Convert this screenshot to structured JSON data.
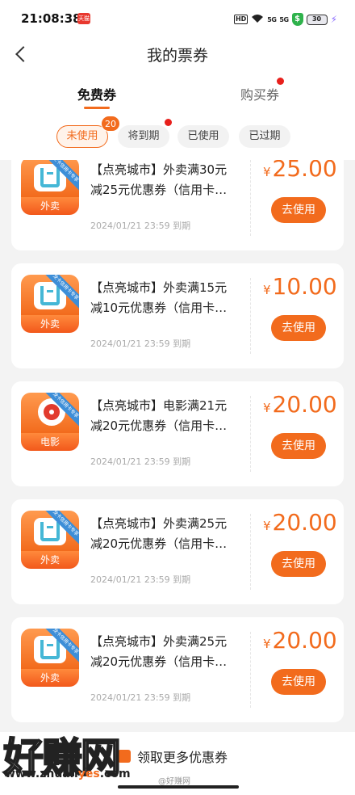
{
  "status_bar": {
    "time": "21:08:38",
    "app_badge": "天猫",
    "hd": "HD",
    "sig1": "5G",
    "sig2": "5G",
    "battery": "30"
  },
  "header": {
    "title": "我的票券"
  },
  "tabs": {
    "free": "免费券",
    "buy": "购买券"
  },
  "filters": {
    "unused": "未使用",
    "unused_count": "20",
    "expiring": "将到期",
    "used": "已使用",
    "expired": "已过期"
  },
  "coupons": [
    {
      "title1": "【点亮城市】外卖满30元",
      "title2": "减25元优惠券（信用卡…",
      "expire": "2024/01/21 23:59 到期",
      "currency": "¥",
      "price": "25.00",
      "button": "去使用",
      "icon_label": "外卖",
      "ribbon": "龙卡信用卡专享"
    },
    {
      "title1": "【点亮城市】外卖满15元",
      "title2": "减10元优惠券（信用卡…",
      "expire": "2024/01/21 23:59 到期",
      "currency": "¥",
      "price": "10.00",
      "button": "去使用",
      "icon_label": "外卖",
      "ribbon": "龙卡信用卡专享"
    },
    {
      "title1": "【点亮城市】电影满21元",
      "title2": "减20元优惠券（信用卡…",
      "expire": "2024/01/21 23:59 到期",
      "currency": "¥",
      "price": "20.00",
      "button": "去使用",
      "icon_label": "电影",
      "ribbon": "龙卡信用卡专享"
    },
    {
      "title1": "【点亮城市】外卖满25元",
      "title2": "减20元优惠券（信用卡…",
      "expire": "2024/01/21 23:59 到期",
      "currency": "¥",
      "price": "20.00",
      "button": "去使用",
      "icon_label": "外卖",
      "ribbon": "龙卡信用卡专享"
    },
    {
      "title1": "【点亮城市】外卖满25元",
      "title2": "减20元优惠券（信用卡…",
      "expire": "2024/01/21 23:59 到期",
      "currency": "¥",
      "price": "20.00",
      "button": "去使用",
      "icon_label": "外卖",
      "ribbon": "龙卡信用卡专享"
    }
  ],
  "bottom": {
    "more": "领取更多优惠券"
  },
  "watermark": {
    "big": "好赚网",
    "url_a": "www.zhuan",
    "url_b": "yes",
    "url_c": ".com",
    "small": "@好赚网"
  }
}
